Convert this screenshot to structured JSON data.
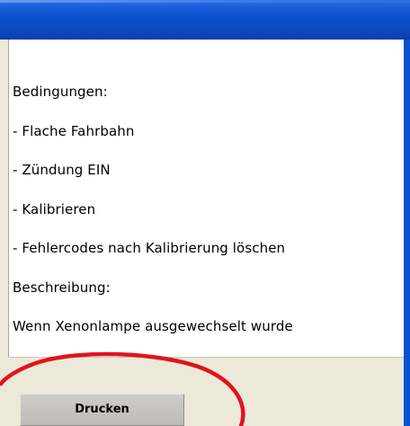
{
  "window": {
    "title": ""
  },
  "content": {
    "lines": [
      "Bedingungen:",
      "- Flache Fahrbahn",
      "- Zündung EIN",
      "- Kalibrieren",
      "- Fehlercodes nach Kalibrierung löschen",
      "Beschreibung:",
      "Wenn Xenonlampe ausgewechselt wurde"
    ]
  },
  "actions": {
    "print_label": "Drucken"
  },
  "colors": {
    "title_bar": "#0a49c2",
    "client_background": "#ece9d8",
    "panel_background": "#ffffff",
    "annotation": "#e0141c"
  }
}
